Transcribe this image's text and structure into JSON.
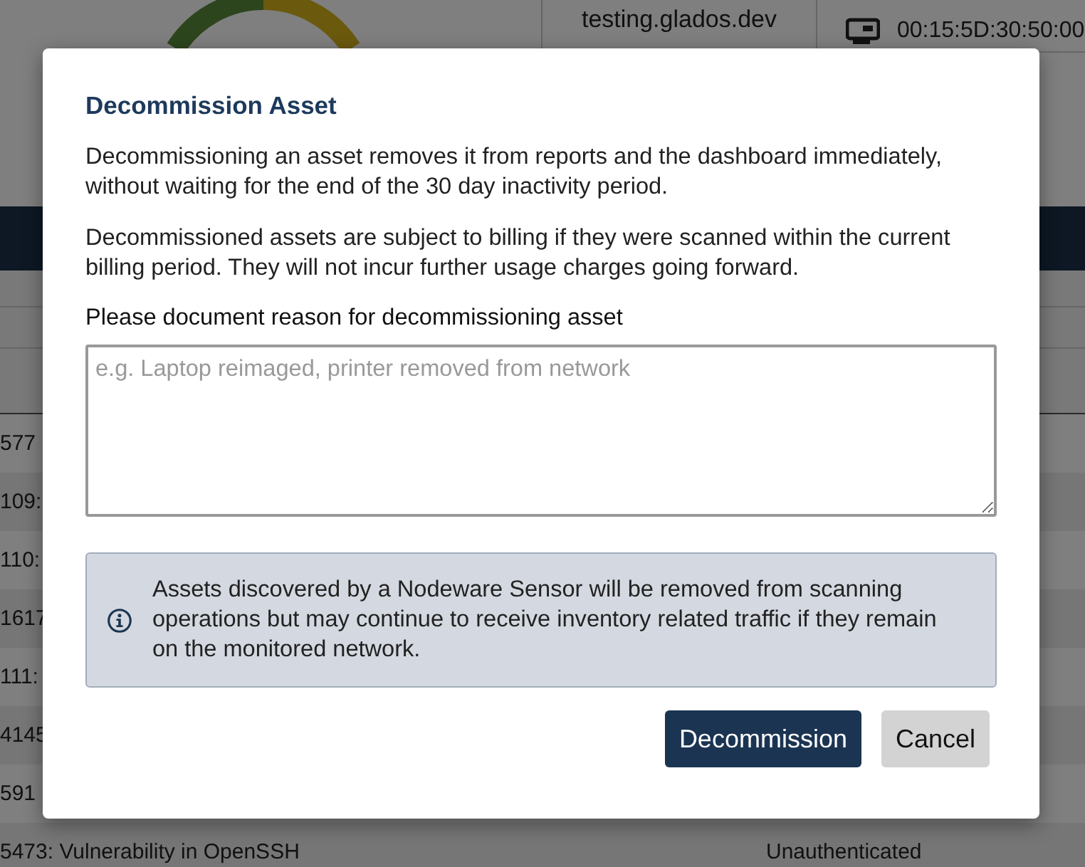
{
  "page": {
    "hostname": "testing.glados.dev",
    "mac_address": "00:15:5D:30:50:00",
    "rows": [
      {
        "column_1": "577"
      },
      {
        "column_1": "109:"
      },
      {
        "column_1": "110:"
      },
      {
        "column_1": "1617"
      },
      {
        "column_1": "111:"
      },
      {
        "column_1": "4145"
      },
      {
        "column_1": "591"
      },
      {
        "column_1": "5473: Vulnerability in OpenSSH",
        "column_2": "Unauthenticated"
      }
    ]
  },
  "dialog": {
    "title": "Decommission Asset",
    "paragraphs": [
      "Decommissioning an asset removes it from reports and the dashboard immediately, without waiting for the end of the 30 day inactivity period.",
      "Decommissioned assets are subject to billing if they were scanned within the current billing period. They will not incur further usage charges going forward."
    ],
    "reason_label": "Please document reason for decommissioning asset",
    "reason_placeholder": "e.g. Laptop reimaged, printer removed from network",
    "notice": "Assets discovered by a Nodeware Sensor will be removed from scanning operations but may continue to receive inventory related traffic if they remain on the monitored network.",
    "buttons": [
      {
        "label": "Decommission",
        "kind": "primary"
      },
      {
        "label": "Cancel",
        "kind": "secondary"
      }
    ]
  }
}
